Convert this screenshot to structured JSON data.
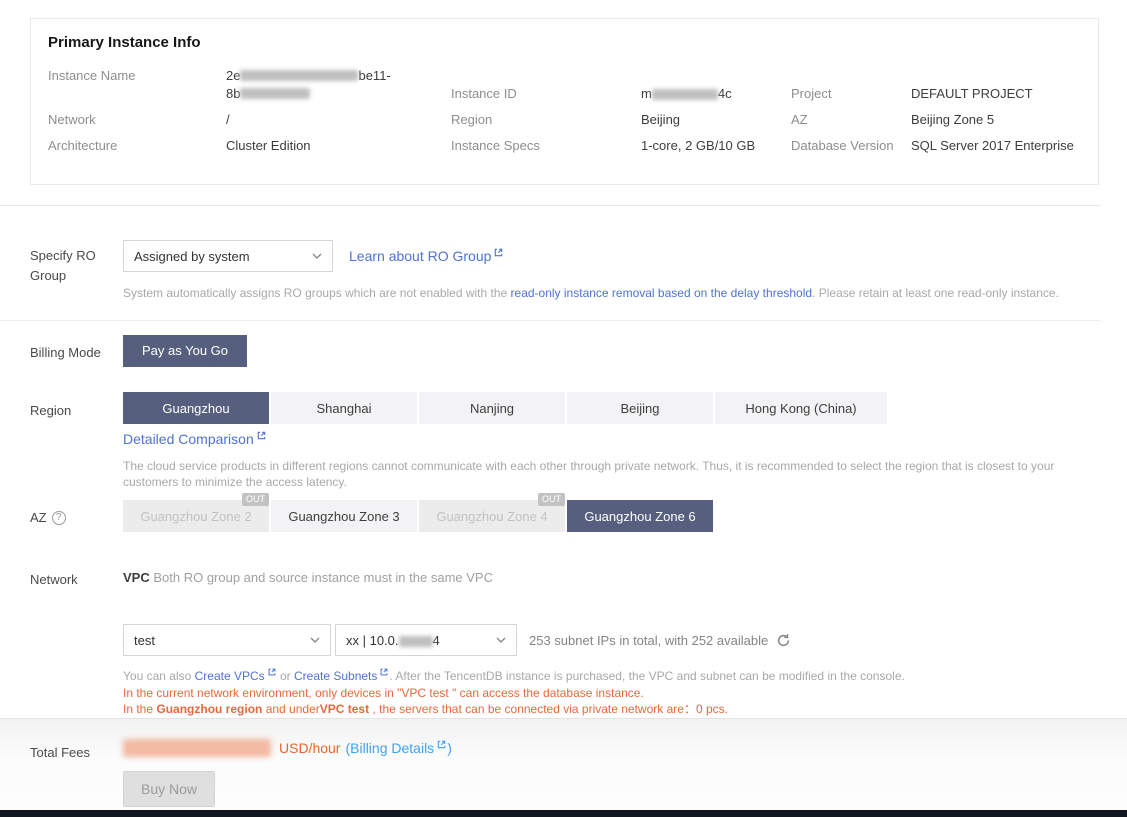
{
  "colors": {
    "accent_slate": "#565f7e",
    "link_indigo": "#4e73d3",
    "link_skyblue": "#3da2f5",
    "warning_orange": "#e8673d",
    "fee_orange": "#e5672f"
  },
  "primary_panel": {
    "title": "Primary Instance Info",
    "instance_name": {
      "label": "Instance Name",
      "line1_prefix": "2e",
      "line1_suffix": "be11-",
      "line2_prefix": "8b"
    },
    "instance_id": {
      "label": "Instance ID",
      "prefix": "m",
      "suffix": "4c"
    },
    "project": {
      "label": "Project",
      "value": "DEFAULT PROJECT"
    },
    "network": {
      "label": "Network",
      "value": "/"
    },
    "region": {
      "label": "Region",
      "value": "Beijing"
    },
    "az": {
      "label": "AZ",
      "value": "Beijing Zone 5"
    },
    "architecture": {
      "label": "Architecture",
      "value": "Cluster Edition"
    },
    "instance_specs": {
      "label": "Instance Specs",
      "value": "1-core, 2 GB/10 GB"
    },
    "database_version": {
      "label": "Database Version",
      "value": "SQL Server 2017 Enterprise"
    }
  },
  "ro_group": {
    "label_line1": "Specify RO",
    "label_line2": "Group",
    "select_value": "Assigned by system",
    "link": "Learn about RO Group",
    "help_prefix": "System automatically assigns RO groups which are not enabled with the ",
    "help_link": "read-only instance removal based on the delay threshold",
    "help_suffix": ". Please retain at least one read-only instance."
  },
  "billing_mode": {
    "label": "Billing Mode",
    "value": "Pay as You Go"
  },
  "region_section": {
    "label": "Region",
    "tabs": [
      {
        "label": "Guangzhou"
      },
      {
        "label": "Shanghai"
      },
      {
        "label": "Nanjing"
      },
      {
        "label": "Beijing"
      },
      {
        "label": "Hong Kong (China)"
      }
    ],
    "link": "Detailed Comparison",
    "description": "The cloud service products in different regions cannot communicate with each other through private network. Thus, it is recommended to select the region that is closest to your customers to minimize the access latency."
  },
  "az_section": {
    "label": "AZ",
    "badge": "OUT",
    "tabs": [
      {
        "label": "Guangzhou Zone 2"
      },
      {
        "label": "Guangzhou Zone 3"
      },
      {
        "label": "Guangzhou Zone 4"
      },
      {
        "label": "Guangzhou Zone 6"
      }
    ]
  },
  "network_section": {
    "label": "Network",
    "vpc_bold": "VPC",
    "vpc_hint": " Both RO group and source instance must in the same VPC",
    "vpc_select_value": "test",
    "subnet_prefix": "xx | 10.0.",
    "subnet_suffix": "4",
    "subnet_info": "253 subnet IPs in total, with 252 available",
    "note_prefix": "You can also ",
    "note_link1": "Create VPCs",
    "note_mid": " or ",
    "note_link2": "Create Subnets",
    "note_suffix": ". After the TencentDB instance is purchased, the VPC and subnet can be modified in the console.",
    "warn1": "In the current network environment, only devices in \"VPC test \" can access the database instance.",
    "warn2_prefix": "In the ",
    "warn2_bold1": "Guangzhou region",
    "warn2_mid": " and under",
    "warn2_bold2": "VPC test",
    "warn2_suffix": " , the servers that can be connected via private network are：0 pcs."
  },
  "footer": {
    "label": "Total Fees",
    "unit": "USD/hour",
    "paren_open": "(",
    "billing_link": "Billing Details",
    "paren_close": ")",
    "buy_button": "Buy Now"
  }
}
